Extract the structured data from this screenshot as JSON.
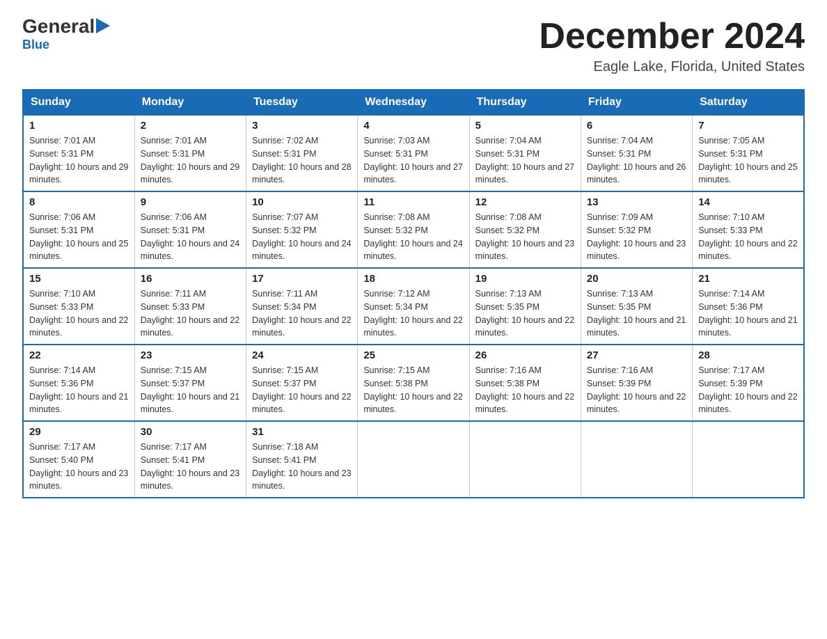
{
  "logo": {
    "text_general": "General",
    "text_blue": "Blue",
    "triangle": "▶"
  },
  "header": {
    "month_year": "December 2024",
    "location": "Eagle Lake, Florida, United States"
  },
  "days_of_week": [
    "Sunday",
    "Monday",
    "Tuesday",
    "Wednesday",
    "Thursday",
    "Friday",
    "Saturday"
  ],
  "weeks": [
    [
      {
        "day": "1",
        "sunrise": "7:01 AM",
        "sunset": "5:31 PM",
        "daylight": "10 hours and 29 minutes."
      },
      {
        "day": "2",
        "sunrise": "7:01 AM",
        "sunset": "5:31 PM",
        "daylight": "10 hours and 29 minutes."
      },
      {
        "day": "3",
        "sunrise": "7:02 AM",
        "sunset": "5:31 PM",
        "daylight": "10 hours and 28 minutes."
      },
      {
        "day": "4",
        "sunrise": "7:03 AM",
        "sunset": "5:31 PM",
        "daylight": "10 hours and 27 minutes."
      },
      {
        "day": "5",
        "sunrise": "7:04 AM",
        "sunset": "5:31 PM",
        "daylight": "10 hours and 27 minutes."
      },
      {
        "day": "6",
        "sunrise": "7:04 AM",
        "sunset": "5:31 PM",
        "daylight": "10 hours and 26 minutes."
      },
      {
        "day": "7",
        "sunrise": "7:05 AM",
        "sunset": "5:31 PM",
        "daylight": "10 hours and 25 minutes."
      }
    ],
    [
      {
        "day": "8",
        "sunrise": "7:06 AM",
        "sunset": "5:31 PM",
        "daylight": "10 hours and 25 minutes."
      },
      {
        "day": "9",
        "sunrise": "7:06 AM",
        "sunset": "5:31 PM",
        "daylight": "10 hours and 24 minutes."
      },
      {
        "day": "10",
        "sunrise": "7:07 AM",
        "sunset": "5:32 PM",
        "daylight": "10 hours and 24 minutes."
      },
      {
        "day": "11",
        "sunrise": "7:08 AM",
        "sunset": "5:32 PM",
        "daylight": "10 hours and 24 minutes."
      },
      {
        "day": "12",
        "sunrise": "7:08 AM",
        "sunset": "5:32 PM",
        "daylight": "10 hours and 23 minutes."
      },
      {
        "day": "13",
        "sunrise": "7:09 AM",
        "sunset": "5:32 PM",
        "daylight": "10 hours and 23 minutes."
      },
      {
        "day": "14",
        "sunrise": "7:10 AM",
        "sunset": "5:33 PM",
        "daylight": "10 hours and 22 minutes."
      }
    ],
    [
      {
        "day": "15",
        "sunrise": "7:10 AM",
        "sunset": "5:33 PM",
        "daylight": "10 hours and 22 minutes."
      },
      {
        "day": "16",
        "sunrise": "7:11 AM",
        "sunset": "5:33 PM",
        "daylight": "10 hours and 22 minutes."
      },
      {
        "day": "17",
        "sunrise": "7:11 AM",
        "sunset": "5:34 PM",
        "daylight": "10 hours and 22 minutes."
      },
      {
        "day": "18",
        "sunrise": "7:12 AM",
        "sunset": "5:34 PM",
        "daylight": "10 hours and 22 minutes."
      },
      {
        "day": "19",
        "sunrise": "7:13 AM",
        "sunset": "5:35 PM",
        "daylight": "10 hours and 22 minutes."
      },
      {
        "day": "20",
        "sunrise": "7:13 AM",
        "sunset": "5:35 PM",
        "daylight": "10 hours and 21 minutes."
      },
      {
        "day": "21",
        "sunrise": "7:14 AM",
        "sunset": "5:36 PM",
        "daylight": "10 hours and 21 minutes."
      }
    ],
    [
      {
        "day": "22",
        "sunrise": "7:14 AM",
        "sunset": "5:36 PM",
        "daylight": "10 hours and 21 minutes."
      },
      {
        "day": "23",
        "sunrise": "7:15 AM",
        "sunset": "5:37 PM",
        "daylight": "10 hours and 21 minutes."
      },
      {
        "day": "24",
        "sunrise": "7:15 AM",
        "sunset": "5:37 PM",
        "daylight": "10 hours and 22 minutes."
      },
      {
        "day": "25",
        "sunrise": "7:15 AM",
        "sunset": "5:38 PM",
        "daylight": "10 hours and 22 minutes."
      },
      {
        "day": "26",
        "sunrise": "7:16 AM",
        "sunset": "5:38 PM",
        "daylight": "10 hours and 22 minutes."
      },
      {
        "day": "27",
        "sunrise": "7:16 AM",
        "sunset": "5:39 PM",
        "daylight": "10 hours and 22 minutes."
      },
      {
        "day": "28",
        "sunrise": "7:17 AM",
        "sunset": "5:39 PM",
        "daylight": "10 hours and 22 minutes."
      }
    ],
    [
      {
        "day": "29",
        "sunrise": "7:17 AM",
        "sunset": "5:40 PM",
        "daylight": "10 hours and 23 minutes."
      },
      {
        "day": "30",
        "sunrise": "7:17 AM",
        "sunset": "5:41 PM",
        "daylight": "10 hours and 23 minutes."
      },
      {
        "day": "31",
        "sunrise": "7:18 AM",
        "sunset": "5:41 PM",
        "daylight": "10 hours and 23 minutes."
      },
      null,
      null,
      null,
      null
    ]
  ],
  "labels": {
    "sunrise": "Sunrise: ",
    "sunset": "Sunset: ",
    "daylight": "Daylight: "
  },
  "colors": {
    "header_bg": "#1a6bb5",
    "border": "#1a6bb5"
  }
}
